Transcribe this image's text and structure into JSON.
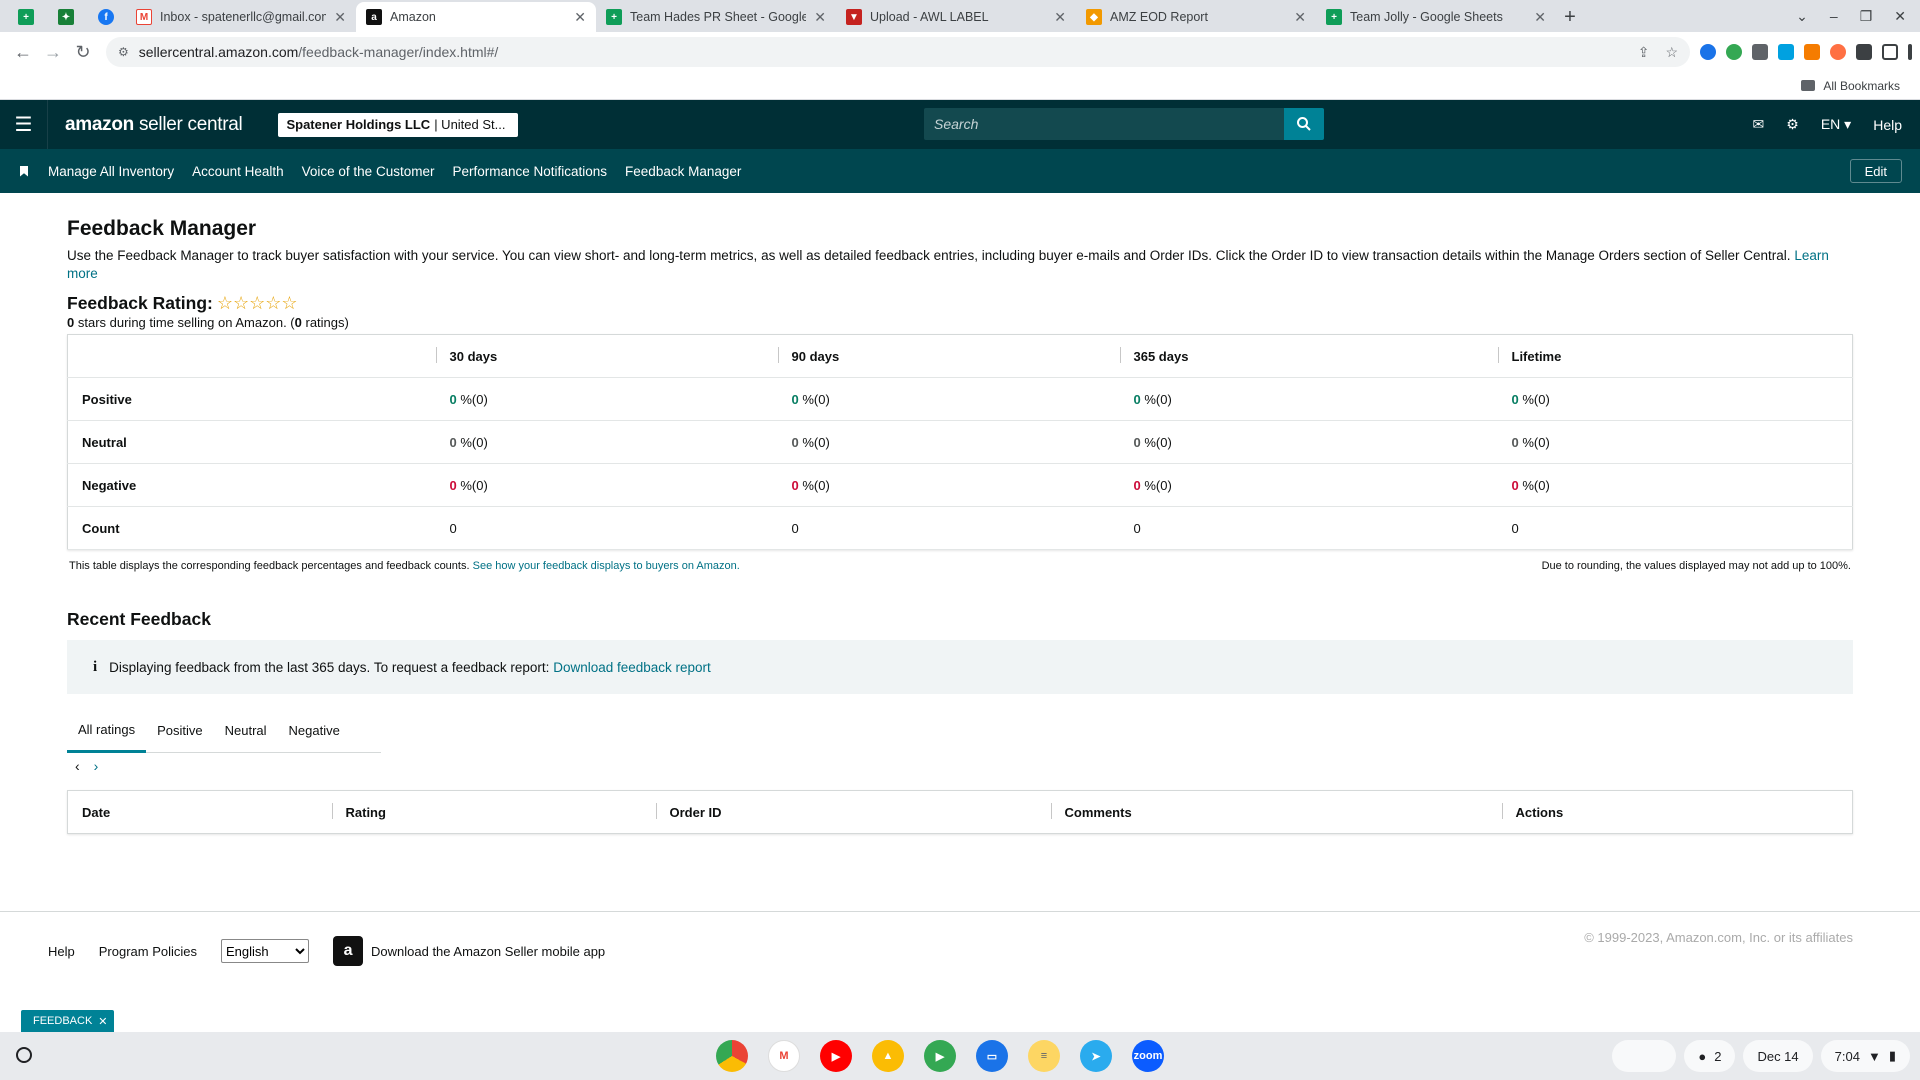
{
  "browser": {
    "tabs": [
      {
        "title": "",
        "pinned": true,
        "icon": "sheets-icon",
        "color": "#0f9d58"
      },
      {
        "title": "",
        "pinned": true,
        "icon": "extension-icon",
        "color": "#188038"
      },
      {
        "title": "",
        "pinned": true,
        "icon": "facebook-icon",
        "color": "#1877f2"
      },
      {
        "title": "Inbox - spatenerllc@gmail.com",
        "icon": "gmail-icon",
        "color": "#ea4335"
      },
      {
        "title": "Amazon",
        "icon": "amazon-icon",
        "color": "#111111",
        "active": true
      },
      {
        "title": "Team Hades PR Sheet - Google",
        "icon": "sheets-icon",
        "color": "#0f9d58"
      },
      {
        "title": "Upload - AWL LABEL",
        "icon": "awl-icon",
        "color": "#c5221f"
      },
      {
        "title": "AMZ EOD Report",
        "icon": "report-icon",
        "color": "#f29900"
      },
      {
        "title": "Team Jolly - Google Sheets",
        "icon": "sheets-icon",
        "color": "#0f9d58"
      }
    ],
    "url_host": "sellercentral.amazon.com",
    "url_path": "/feedback-manager/index.html#/",
    "bookmarks_label": "All Bookmarks"
  },
  "header": {
    "logo_amazon": "amazon",
    "logo_suffix": "seller central",
    "account_name": "Spatener Holdings LLC",
    "account_region": "| United St...",
    "search_placeholder": "Search",
    "lang": "EN",
    "help": "Help"
  },
  "nav": {
    "items": [
      "Manage All Inventory",
      "Account Health",
      "Voice of the Customer",
      "Performance Notifications",
      "Feedback Manager"
    ],
    "edit": "Edit"
  },
  "page": {
    "title": "Feedback Manager",
    "intro": "Use the Feedback Manager to track buyer satisfaction with your service. You can view short- and long-term metrics, as well as detailed feedback entries, including buyer e-mails and Order IDs. Click the Order ID to view transaction details within the Manage Orders section of Seller Central.",
    "learn_more": "Learn more",
    "rating_title": "Feedback Rating:",
    "stars": "☆☆☆☆☆",
    "rating_stars_value": "0",
    "rating_sub_mid": "stars during time selling on Amazon. (",
    "rating_count": "0",
    "rating_sub_end": "ratings)"
  },
  "feedback_table": {
    "columns": [
      "",
      "30 days",
      "90 days",
      "365 days",
      "Lifetime"
    ],
    "rows": [
      {
        "label": "Positive",
        "values": [
          "0",
          "0",
          "0",
          "0"
        ],
        "suffix": "%(0)"
      },
      {
        "label": "Neutral",
        "values": [
          "0",
          "0",
          "0",
          "0"
        ],
        "suffix": "%(0)"
      },
      {
        "label": "Negative",
        "values": [
          "0",
          "0",
          "0",
          "0"
        ],
        "suffix": "%(0)"
      },
      {
        "label": "Count",
        "values": [
          "0",
          "0",
          "0",
          "0"
        ],
        "suffix": ""
      }
    ],
    "note_left": "This table displays the corresponding feedback percentages and feedback counts.",
    "note_link": "See how your feedback displays to buyers on Amazon.",
    "note_right": "Due to rounding, the values displayed may not add up to 100%."
  },
  "recent": {
    "title": "Recent Feedback",
    "info_icon": "i",
    "alert_text": "Displaying feedback from the last 365 days. To request a feedback report:",
    "alert_link": "Download feedback report",
    "tabs": [
      "All ratings",
      "Positive",
      "Neutral",
      "Negative"
    ],
    "prev": "‹",
    "next": "›",
    "columns": [
      "Date",
      "Rating",
      "Order ID",
      "Comments",
      "Actions"
    ]
  },
  "footer": {
    "help": "Help",
    "policies": "Program Policies",
    "language": "English",
    "app_text": "Download the Amazon Seller mobile app",
    "copyright": "© 1999-2023, Amazon.com, Inc. or its affiliates"
  },
  "feedback_tab": "FEEDBACK",
  "shelf": {
    "date": "Dec 14",
    "time": "7:04",
    "notif_count": "2"
  }
}
